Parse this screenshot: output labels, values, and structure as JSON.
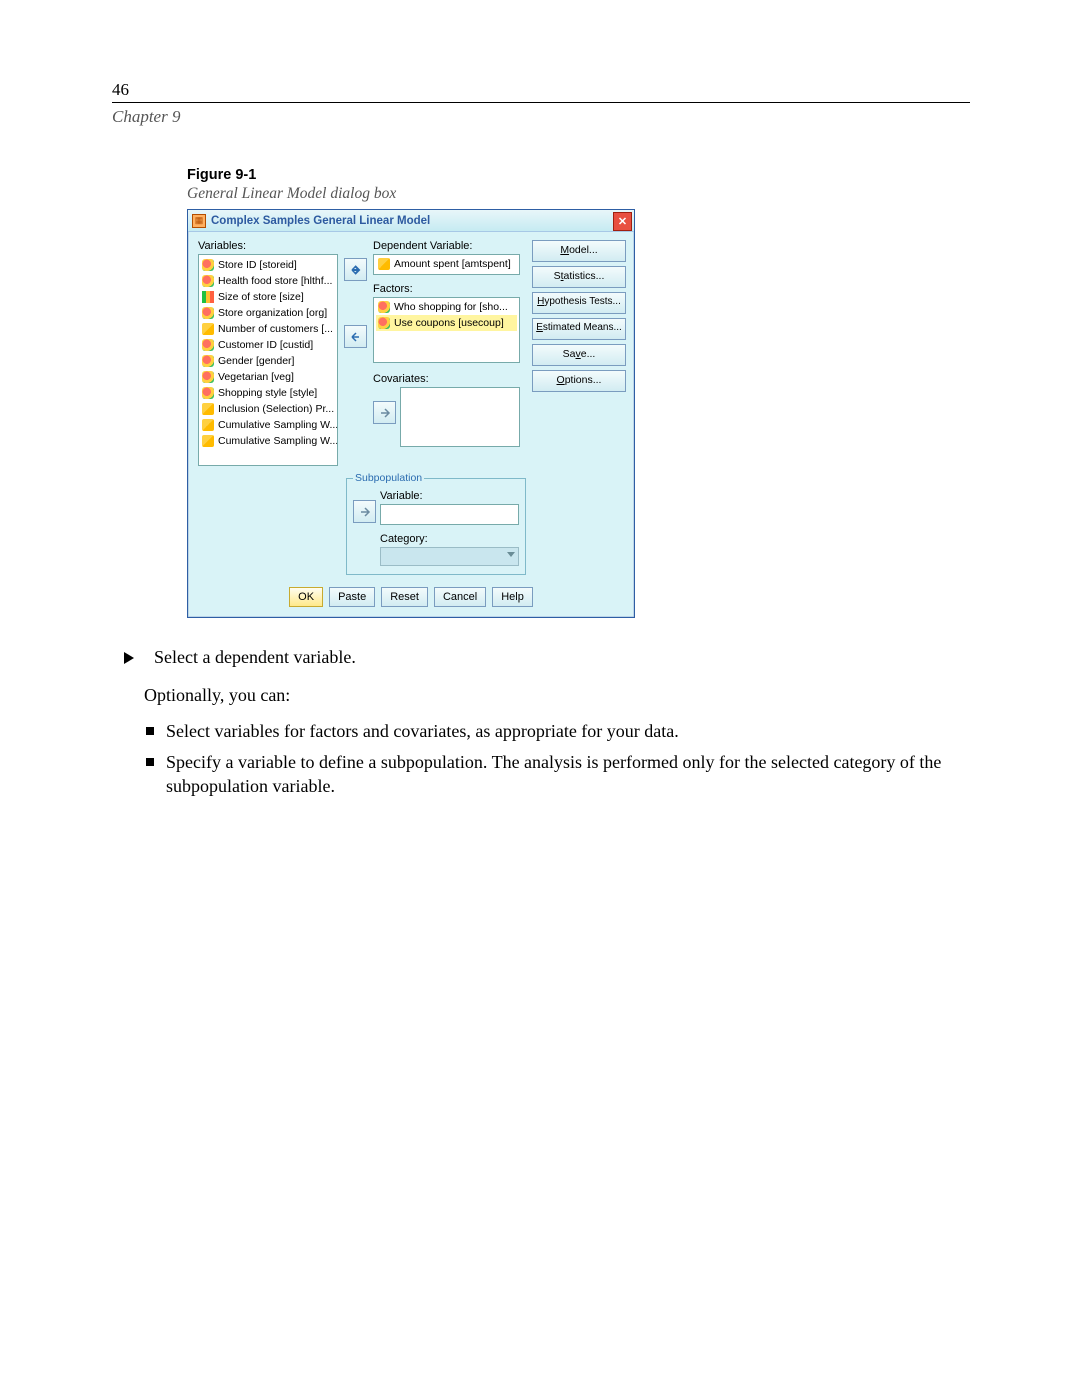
{
  "page": {
    "num": "46",
    "chapter": "Chapter 9"
  },
  "figure": {
    "label": "Figure 9-1",
    "caption": "General Linear Model dialog box"
  },
  "dialog": {
    "title": "Complex Samples General Linear Model",
    "labels": {
      "variables": "Variables:",
      "dependent": "Dependent Variable:",
      "factors": "Factors:",
      "covariates": "Covariates:",
      "subpop_legend": "Subpopulation",
      "subpop_var": "Variable:",
      "subpop_cat": "Category:"
    },
    "variables": [
      {
        "icon": "nominal",
        "text": "Store ID [storeid]"
      },
      {
        "icon": "nominal",
        "text": "Health food store [hlthf..."
      },
      {
        "icon": "ordinal",
        "text": "Size of store [size]"
      },
      {
        "icon": "nominal",
        "text": "Store organization [org]"
      },
      {
        "icon": "scale",
        "text": "Number of customers [..."
      },
      {
        "icon": "nominal",
        "text": "Customer ID [custid]"
      },
      {
        "icon": "nominal",
        "text": "Gender [gender]"
      },
      {
        "icon": "nominal",
        "text": "Vegetarian [veg]"
      },
      {
        "icon": "nominal",
        "text": "Shopping style [style]"
      },
      {
        "icon": "scale",
        "text": "Inclusion (Selection) Pr..."
      },
      {
        "icon": "scale",
        "text": "Cumulative Sampling W..."
      },
      {
        "icon": "scale",
        "text": "Cumulative Sampling W..."
      }
    ],
    "dependent": {
      "icon": "scale",
      "text": "Amount spent [amtspent]"
    },
    "factors": [
      {
        "icon": "nominal",
        "text": "Who shopping for [sho..."
      },
      {
        "icon": "nominal",
        "text": "Use coupons [usecoup]",
        "selected": true
      }
    ],
    "side_buttons": {
      "model": "Model...",
      "stats": "Statistics...",
      "htests": "Hypothesis Tests...",
      "emeans": "Estimated Means...",
      "save": "Save...",
      "options": "Options..."
    },
    "foot": {
      "ok": "OK",
      "paste": "Paste",
      "reset": "Reset",
      "cancel": "Cancel",
      "help": "Help"
    }
  },
  "body": {
    "step": "Select a dependent variable.",
    "optional": "Optionally, you can:",
    "bullets": [
      "Select variables for factors and covariates, as appropriate for your data.",
      "Specify a variable to define a subpopulation. The analysis is performed only for the selected category of the subpopulation variable."
    ]
  }
}
